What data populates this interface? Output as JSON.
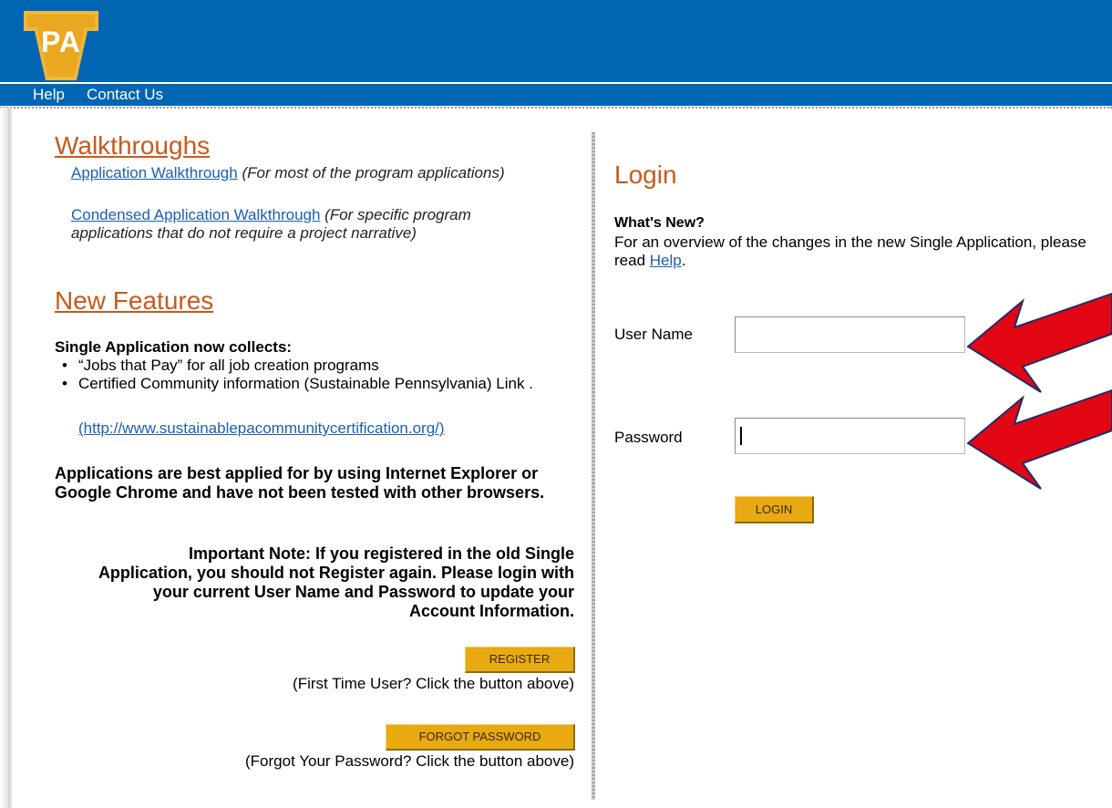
{
  "header": {
    "logo_text": "PA",
    "nav": [
      "Help",
      "Contact Us"
    ]
  },
  "walkthroughs": {
    "heading": "Walkthroughs",
    "items": [
      {
        "link": "Application Walkthrough",
        "note": "(For most of the program applications)"
      },
      {
        "link": "Condensed Application Walkthrough",
        "note": "(For specific program applications that do not require a project narrative)"
      }
    ]
  },
  "new_features": {
    "heading": "New Features",
    "collects": "Single Application now collects:",
    "bullets": [
      "“Jobs that Pay” for all job creation programs",
      "Certified Community information (Sustainable Pennsylvania) Link              ."
    ],
    "link": "(http://www.sustainablepacommunitycertification.org/)"
  },
  "browsers_note": "Applications are best applied for by using Internet Explorer or Google Chrome and have not been tested with other browsers.",
  "important_note": "Important Note: If you registered in the old Single Application, you should not Register again. Please login with your current User Name and Password to update your Account Information.",
  "register": {
    "button": "REGISTER",
    "caption": "(First Time User? Click the button above)"
  },
  "forgot": {
    "button": "FORGOT PASSWORD",
    "caption": "(Forgot Your Password? Click the button above)"
  },
  "login": {
    "title": "Login",
    "whats_new": "What's New?",
    "overview_text": "For an overview of the changes in the new Single Application, please read",
    "overview_link": "Help",
    "overview_end": ".",
    "username_label": "User Name",
    "username_value": "",
    "password_label": "Password",
    "password_value": "",
    "button": "LOGIN"
  },
  "colors": {
    "banner": "#0066b3",
    "heading": "#c95a1a",
    "button": "#e8a911",
    "arrow": "#e30613",
    "link": "#1a5fb4"
  }
}
